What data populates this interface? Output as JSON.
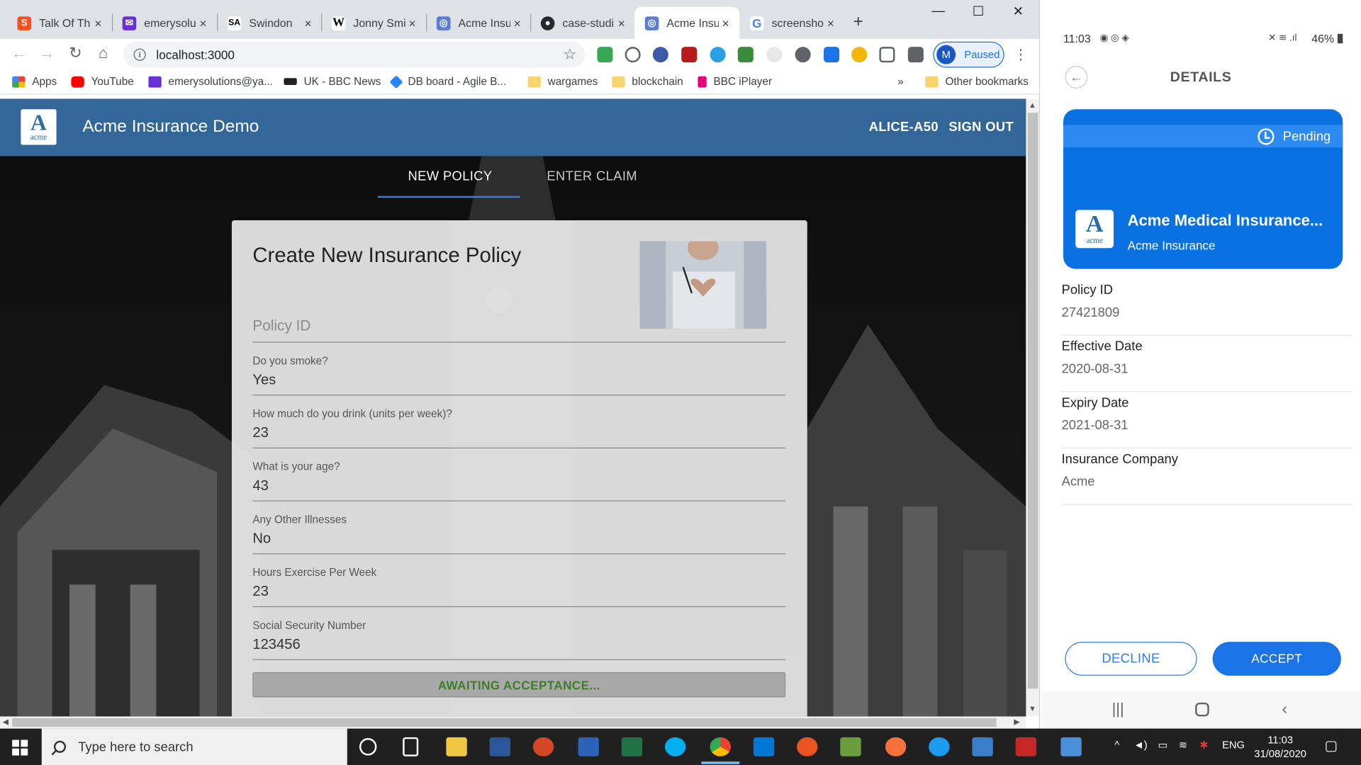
{
  "browser": {
    "tabs": [
      {
        "title": "Talk Of Th",
        "fav_color": "#f4511e",
        "fav_glyph": "S"
      },
      {
        "title": "emerysolu",
        "fav_color": "#6b2fd6",
        "fav_glyph": "✉"
      },
      {
        "title": "Swindon",
        "fav_color": "#ffffff",
        "fav_glyph": "SA"
      },
      {
        "title": "Jonny Smi",
        "fav_color": "#ffffff",
        "fav_glyph": "W"
      },
      {
        "title": "Acme Insu",
        "fav_color": "#5c7cd6",
        "fav_glyph": "◎"
      },
      {
        "title": "case-studi",
        "fav_color": "#24292e",
        "fav_glyph": "●"
      },
      {
        "title": "Acme Insu",
        "fav_color": "#5c7cd6",
        "fav_glyph": "◎"
      },
      {
        "title": "screensho",
        "fav_color": "#4285f4",
        "fav_glyph": "G"
      }
    ],
    "new_tab_glyph": "+",
    "close_glyph": "×",
    "url": "localhost:3000",
    "profile": {
      "initial": "M",
      "label": "Paused"
    },
    "bookmarks": [
      {
        "label": "Apps",
        "icon": "apps-grid-icon",
        "color": "#4285f4"
      },
      {
        "label": "YouTube",
        "icon": "youtube-icon",
        "color": "#ff0000"
      },
      {
        "label": "emerysolutions@ya...",
        "icon": "mail-icon",
        "color": "#6b2fd6"
      },
      {
        "label": "UK - BBC News",
        "icon": "bbc-icon",
        "color": "#222222"
      },
      {
        "label": "DB board - Agile B...",
        "icon": "jira-icon",
        "color": "#2684ff"
      },
      {
        "label": "wargames",
        "icon": "folder-icon",
        "color": "#f6d56e"
      },
      {
        "label": "blockchain",
        "icon": "folder-icon",
        "color": "#f6d56e"
      },
      {
        "label": "BBC iPlayer",
        "icon": "iplayer-icon",
        "color": "#e6007e"
      }
    ],
    "bookmarks_overflow": "»",
    "other_bookmarks": "Other bookmarks"
  },
  "app": {
    "title": "Acme Insurance Demo",
    "logo_letter": "A",
    "logo_word": "acme",
    "user": "ALICE-A50",
    "sign_out": "SIGN OUT",
    "tabs": [
      {
        "label": "NEW POLICY",
        "active": true
      },
      {
        "label": "ENTER CLAIM",
        "active": false
      }
    ],
    "form": {
      "title": "Create New Insurance Policy",
      "policy_id_placeholder": "Policy ID",
      "fields": [
        {
          "label": "Do you smoke?",
          "value": "Yes"
        },
        {
          "label": "How much do you drink (units per week)?",
          "value": "23"
        },
        {
          "label": "What is your age?",
          "value": "43"
        },
        {
          "label": "Any Other Illnesses",
          "value": "No"
        },
        {
          "label": "Hours Exercise Per Week",
          "value": "23"
        },
        {
          "label": "Social Security Number",
          "value": "123456"
        }
      ],
      "status_button": "AWAITING ACCEPTANCE..."
    },
    "accent_color": "#336699"
  },
  "phone": {
    "status_time": "11:03",
    "status_battery": "46%",
    "header_title": "DETAILS",
    "card": {
      "status": "Pending",
      "name": "Acme Medical Insurance...",
      "company": "Acme Insurance",
      "logo_letter": "A",
      "logo_word": "acme"
    },
    "details": [
      {
        "key": "Policy ID",
        "value": "27421809"
      },
      {
        "key": "Effective Date",
        "value": "2020-08-31"
      },
      {
        "key": "Expiry Date",
        "value": "2021-08-31"
      },
      {
        "key": "Insurance Company",
        "value": "Acme"
      }
    ],
    "decline": "DECLINE",
    "accept": "ACCEPT"
  },
  "taskbar": {
    "search_placeholder": "Type here to search",
    "language": "ENG",
    "time": "11:03",
    "date": "31/08/2020"
  }
}
